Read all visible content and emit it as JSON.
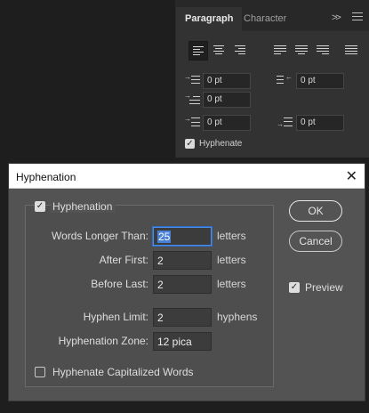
{
  "panel": {
    "tabs": [
      "Paragraph",
      "Character"
    ],
    "collapse_glyph": ">>",
    "indents": {
      "left": "0 pt",
      "right": "0 pt",
      "first_line": "0 pt",
      "space_before": "0 pt",
      "space_after": "0 pt"
    },
    "hyphenate_label": "Hyphenate",
    "hyphenate_checked": true
  },
  "dialog": {
    "title": "Hyphenation",
    "close_glyph": "✕",
    "hyphenation_label": "Hyphenation",
    "hyphenation_checked": true,
    "fields": {
      "words_longer_than": {
        "label": "Words Longer Than:",
        "value": "25",
        "unit": "letters"
      },
      "after_first": {
        "label": "After First:",
        "value": "2",
        "unit": "letters"
      },
      "before_last": {
        "label": "Before Last:",
        "value": "2",
        "unit": "letters"
      },
      "hyphen_limit": {
        "label": "Hyphen Limit:",
        "value": "2",
        "unit": "hyphens"
      },
      "hyphenation_zone": {
        "label": "Hyphenation Zone:",
        "value": "12 pica"
      }
    },
    "cap_words_label": "Hyphenate Capitalized Words",
    "cap_words_checked": false,
    "ok_label": "OK",
    "cancel_label": "Cancel",
    "preview_label": "Preview",
    "preview_checked": true
  }
}
